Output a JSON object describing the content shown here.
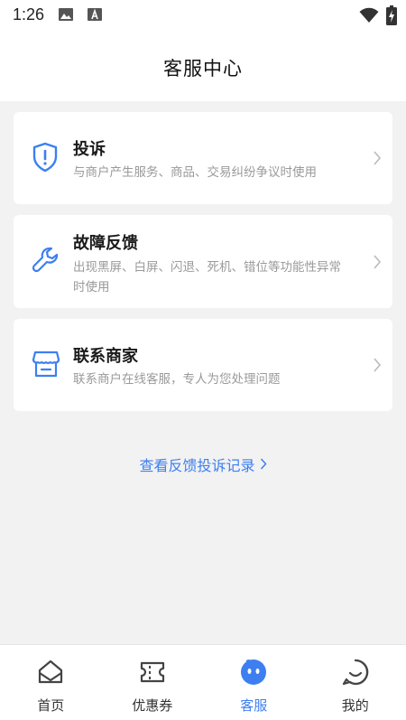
{
  "status_bar": {
    "time": "1:26"
  },
  "header": {
    "title": "客服中心"
  },
  "cards": [
    {
      "title": "投诉",
      "desc": "与商户产生服务、商品、交易纠纷争议时使用",
      "icon": "shield-alert-icon"
    },
    {
      "title": "故障反馈",
      "desc": "出现黑屏、白屏、闪退、死机、错位等功能性异常时使用",
      "icon": "wrench-icon"
    },
    {
      "title": "联系商家",
      "desc": "联系商户在线客服，专人为您处理问题",
      "icon": "store-icon"
    }
  ],
  "records_link": {
    "label": "查看反馈投诉记录"
  },
  "tabbar": {
    "tabs": [
      {
        "label": "首页",
        "icon": "home-icon"
      },
      {
        "label": "优惠券",
        "icon": "coupon-icon"
      },
      {
        "label": "客服",
        "icon": "service-icon",
        "active": true
      },
      {
        "label": "我的",
        "icon": "profile-icon"
      }
    ]
  },
  "colors": {
    "accent": "#3d7ff0",
    "background": "#f2f2f2",
    "muted_text": "#9a9a9a"
  }
}
